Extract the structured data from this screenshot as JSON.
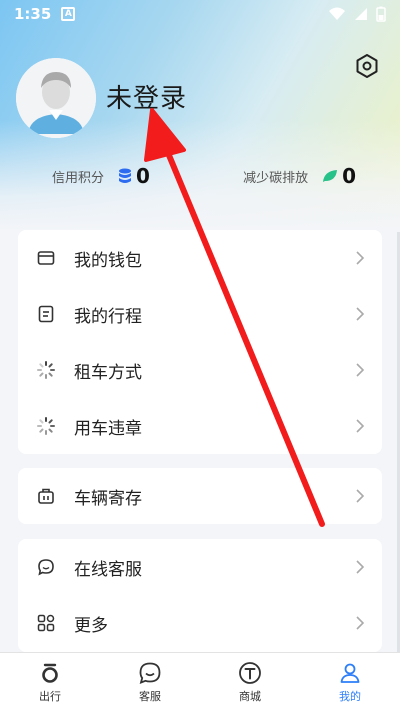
{
  "status_bar": {
    "time": "1:35",
    "notification_letter": "A"
  },
  "profile": {
    "login_status": "未登录"
  },
  "stats": {
    "credit_label": "信用积分",
    "credit_value": "0",
    "carbon_label": "减少碳排放",
    "carbon_value": "0"
  },
  "menu_group_1": [
    {
      "label": "我的钱包",
      "icon": "wallet-icon"
    },
    {
      "label": "我的行程",
      "icon": "itinerary-icon"
    },
    {
      "label": "租车方式",
      "icon": "loading-spinner-icon"
    },
    {
      "label": "用车违章",
      "icon": "loading-spinner-icon"
    }
  ],
  "menu_group_2": [
    {
      "label": "车辆寄存",
      "icon": "luggage-icon"
    }
  ],
  "menu_group_3": [
    {
      "label": "在线客服",
      "icon": "chat-icon"
    },
    {
      "label": "更多",
      "icon": "grid-icon"
    }
  ],
  "tabs": [
    {
      "label": "出行",
      "icon": "travel-icon"
    },
    {
      "label": "客服",
      "icon": "service-icon"
    },
    {
      "label": "商城",
      "icon": "shop-icon"
    },
    {
      "label": "我的",
      "icon": "profile-icon"
    }
  ],
  "colors": {
    "accent": "#2d7ff9",
    "annotation_arrow": "#f21c1c",
    "coin": "#2d6cf0",
    "leaf": "#27c18a"
  }
}
